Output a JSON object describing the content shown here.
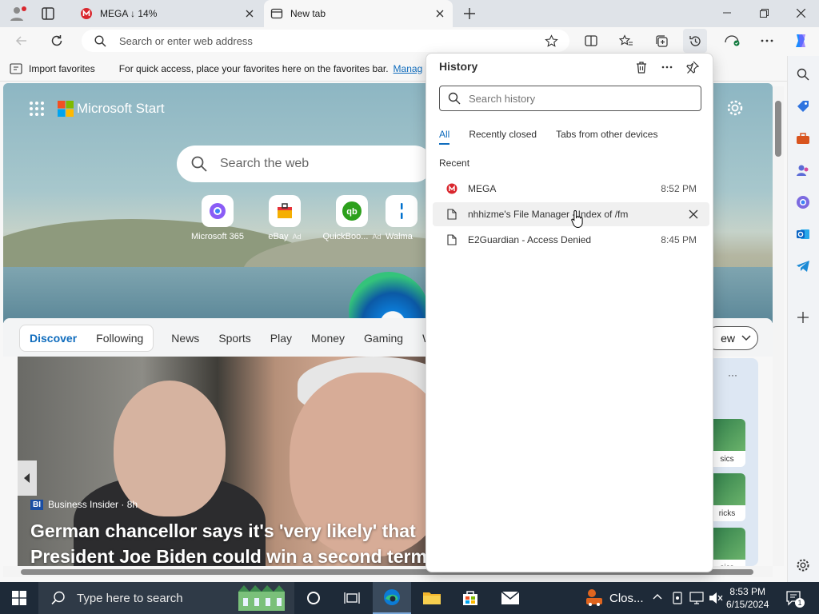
{
  "browser": {
    "tabs": [
      {
        "label": "MEGA ↓ 14%",
        "favicon": "mega-icon"
      },
      {
        "label": "New tab",
        "favicon": "newtab-icon"
      }
    ],
    "address_placeholder": "Search or enter web address",
    "favorites_bar": {
      "import_label": "Import favorites",
      "message": "For quick access, place your favorites here on the favorites bar.",
      "manage_link": "Manag"
    }
  },
  "history_panel": {
    "title": "History",
    "search_placeholder": "Search history",
    "tabs": [
      "All",
      "Recently closed",
      "Tabs from other devices"
    ],
    "section_label": "Recent",
    "items": [
      {
        "title": "MEGA",
        "time": "8:52 PM",
        "icon": "mega-icon"
      },
      {
        "title": "nhhizme's File Manager - Index of /fm",
        "time": "",
        "icon": "page-icon"
      },
      {
        "title": "E2Guardian - Access Denied",
        "time": "8:45 PM",
        "icon": "page-icon"
      }
    ]
  },
  "newtab": {
    "brand": "Microsoft Start",
    "search_placeholder": "Search the web",
    "quick_links": [
      {
        "label": "Microsoft 365"
      },
      {
        "label": "eBay",
        "ad": "Ad"
      },
      {
        "label": "QuickBoo...",
        "ad": "Ad"
      },
      {
        "label": "Walma"
      }
    ],
    "feed_tabs": [
      "Discover",
      "Following",
      "News",
      "Sports",
      "Play",
      "Money",
      "Gaming",
      "W"
    ],
    "view_button": "ew",
    "news": {
      "source_badge": "BI",
      "source": "Business Insider · 8h",
      "headline": "German chancellor says it's 'very likely' that President Joe Biden could win a second term"
    },
    "side_cards": [
      "sics",
      "ricks",
      "sics"
    ],
    "more_dots": "···"
  },
  "taskbar": {
    "search_placeholder": "Type here to search",
    "tray_label": "Clos...",
    "time": "8:53 PM",
    "date": "6/15/2024",
    "notification_count": "1"
  },
  "colors": {
    "accent": "#0f6cbd",
    "mega_red": "#d9272e",
    "taskbar": "#1e2a38"
  }
}
